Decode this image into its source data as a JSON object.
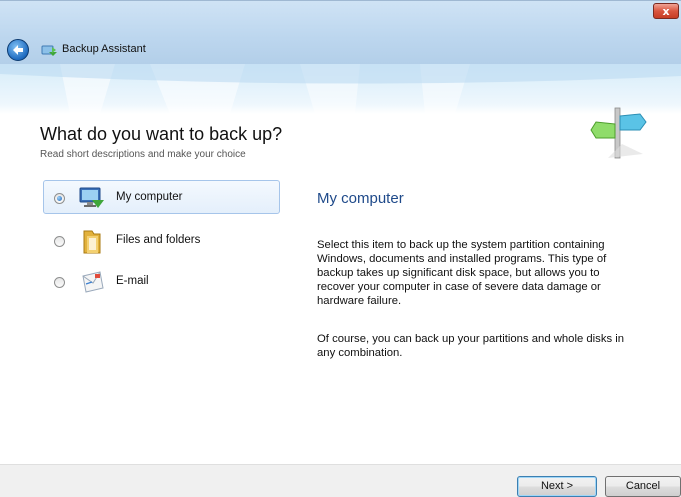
{
  "window": {
    "title": "Backup Assistant",
    "close_label": "x"
  },
  "page": {
    "title": "What do you want to back up?",
    "subtitle": "Read short descriptions and make your choice"
  },
  "options": [
    {
      "label": "My computer",
      "selected": true,
      "icon": "computer-icon"
    },
    {
      "label": "Files and folders",
      "selected": false,
      "icon": "folder-icon"
    },
    {
      "label": "E-mail",
      "selected": false,
      "icon": "email-icon"
    }
  ],
  "description": {
    "title": "My computer",
    "paragraph1": "Select this item to back up the system partition containing Windows, documents and installed programs. This type of backup takes up significant disk space, but allows you to recover your computer in case of severe data damage or hardware failure.",
    "paragraph2": "Of course, you can back up your partitions and whole disks in any combination."
  },
  "footer": {
    "next_label": "Next >",
    "cancel_label": "Cancel"
  },
  "colors": {
    "accent": "#1f4a8a",
    "selection": "#a6c5ea"
  }
}
